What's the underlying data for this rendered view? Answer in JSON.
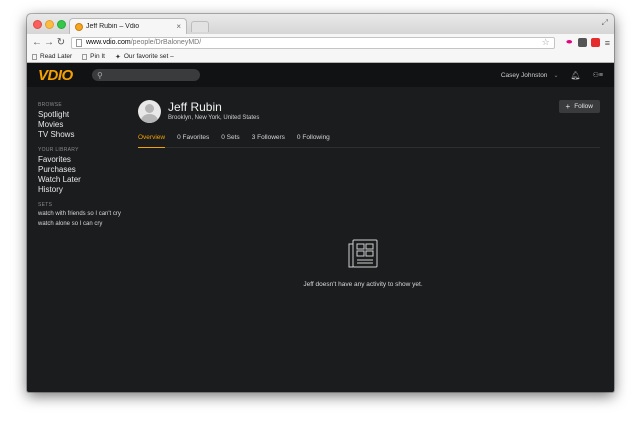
{
  "browser": {
    "tab_title": "Jeff Rubin – Vdio",
    "url_host": "www.vdio.com",
    "url_path": "/people/DrBaloneyMD/",
    "bookmarks": [
      "Read Later",
      "Pin It",
      "Our favorite set –"
    ]
  },
  "site": {
    "logo": "VDIO",
    "user_name": "Casey Johnston",
    "brand_color": "#f5a100"
  },
  "sidebar": {
    "browse_heading": "BROWSE",
    "browse_items": [
      "Spotlight",
      "Movies",
      "TV Shows"
    ],
    "library_heading": "YOUR LIBRARY",
    "library_items": [
      "Favorites",
      "Purchases",
      "Watch Later",
      "History"
    ],
    "sets_heading": "SETS",
    "sets_items": [
      "watch with friends so I can't cry",
      "watch alone so I can cry"
    ]
  },
  "profile": {
    "name": "Jeff Rubin",
    "location": "Brooklyn, New York, United States",
    "follow_label": "Follow",
    "tabs": [
      "Overview",
      "0 Favorites",
      "0 Sets",
      "3 Followers",
      "0 Following"
    ]
  },
  "empty_state": {
    "message": "Jeff doesn't have any activity to show yet."
  }
}
